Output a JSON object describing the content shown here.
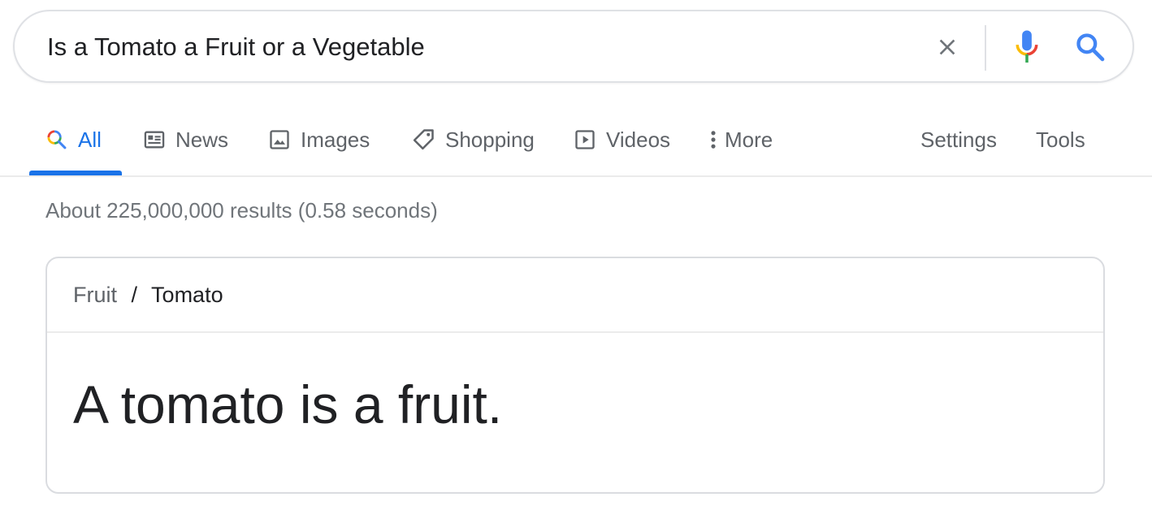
{
  "search": {
    "query": "Is a Tomato a Fruit or a Vegetable",
    "clear_icon": "close-icon",
    "mic_icon": "microphone-icon",
    "search_icon": "search-icon"
  },
  "tabs": [
    {
      "label": "All",
      "icon": "search-icon",
      "active": true
    },
    {
      "label": "News",
      "icon": "news-icon"
    },
    {
      "label": "Images",
      "icon": "image-icon"
    },
    {
      "label": "Shopping",
      "icon": "tag-icon"
    },
    {
      "label": "Videos",
      "icon": "video-icon"
    },
    {
      "label": "More",
      "icon": "more-vert-icon"
    }
  ],
  "tools": {
    "settings_label": "Settings",
    "tools_label": "Tools"
  },
  "result_stats": "About 225,000,000 results (0.58 seconds)",
  "card": {
    "breadcrumb_parent": "Fruit",
    "breadcrumb_sep": "/",
    "breadcrumb_current": "Tomato",
    "answer": "A tomato is a fruit."
  },
  "colors": {
    "accent": "#1a73e8",
    "google_blue": "#4285f4",
    "google_red": "#ea4335",
    "google_yellow": "#fbbc05",
    "google_green": "#34a853",
    "text": "#202124",
    "muted": "#5f6368"
  }
}
